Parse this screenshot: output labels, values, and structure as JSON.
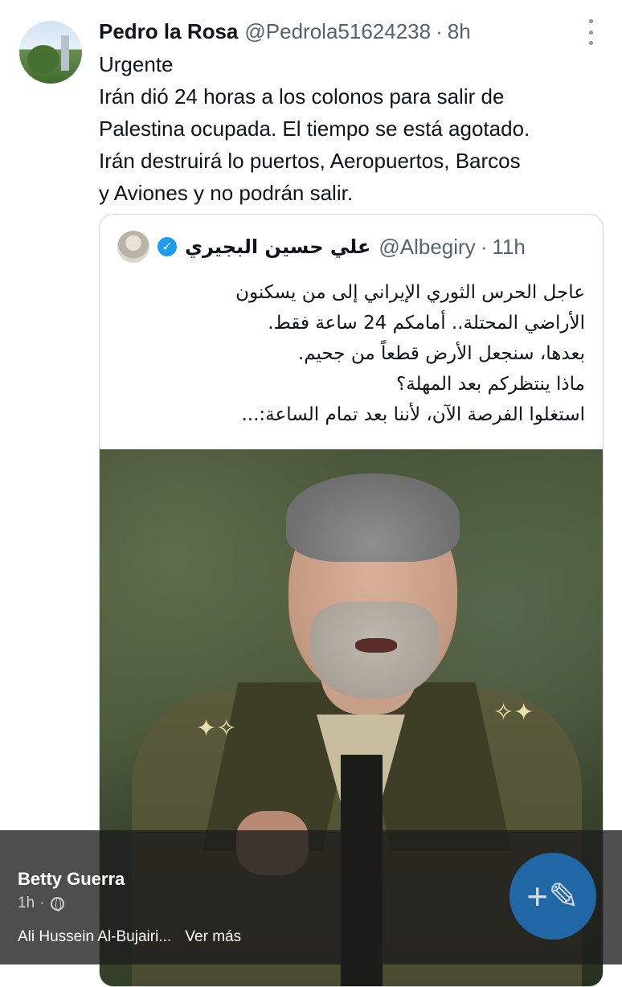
{
  "tweet": {
    "author_name": "Pedro la Rosa",
    "handle": "@Pedrola51624238",
    "separator": "·",
    "time": "8h",
    "lines": [
      "Urgente",
      "Irán dió 24 horas a los colonos para salir de",
      "Palestina ocupada. El tiempo se está agotado.",
      "Irán destruirá lo puertos, Aeropuertos, Barcos",
      "y Aviones y no podrán salir."
    ]
  },
  "quote": {
    "author_name": "علي حسين البجيري",
    "handle": "@Albegiry",
    "separator": "·",
    "time": "11h",
    "verified_glyph": "✓",
    "lines": [
      "عاجل الحرس الثوري الإيراني إلى من يسكنون",
      "الأراضي المحتلة.. أمامكم 24 ساعة فقط.",
      "بعدها، سنجعل الأرض قطعاً من جحيم.",
      "ماذا ينتظركم بعد المهلة؟",
      "استغلوا الفرصة الآن، لأننا بعد تمام الساعة:..."
    ]
  },
  "facebook_overlay": {
    "poster_name": "Betty Guerra",
    "meta_time": "1h",
    "meta_separator": "·",
    "caption": "Ali Hussein Al-Bujairi...",
    "see_more": "Ver más",
    "compose_glyph": "+✎"
  },
  "colors": {
    "verified_blue": "#1d9bf0",
    "fab_blue": "#1f6fb4",
    "muted_text": "#536471"
  }
}
